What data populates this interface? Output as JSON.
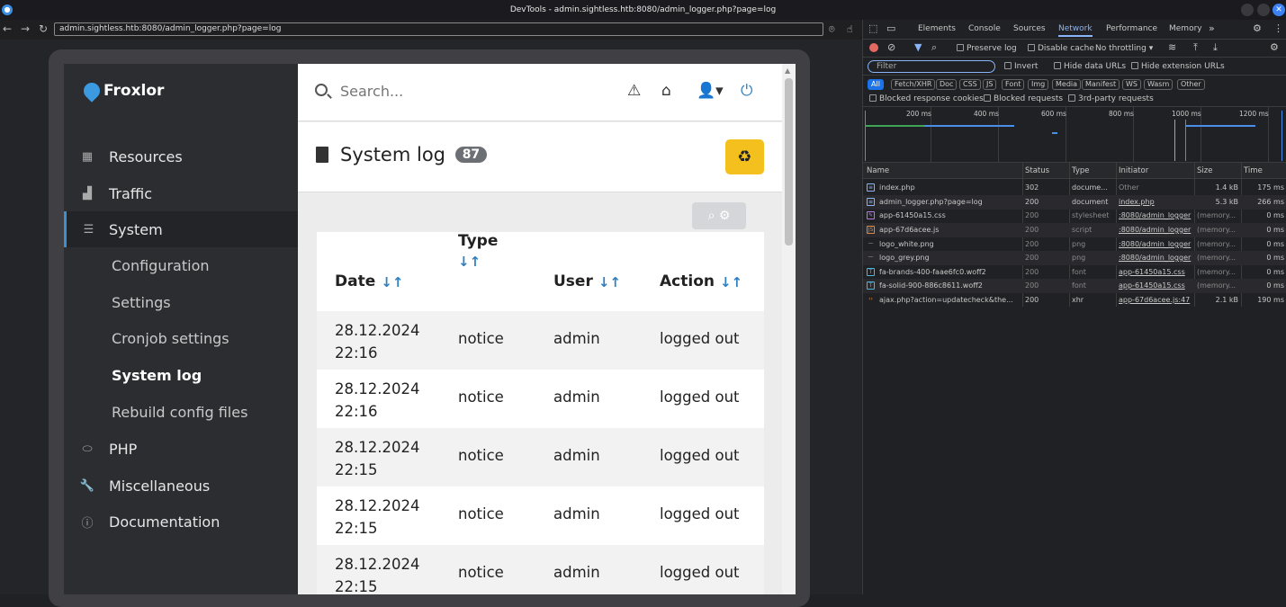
{
  "window": {
    "title": "DevTools - admin.sightless.htb:8080/admin_logger.php?page=log"
  },
  "browser": {
    "url": "admin.sightless.htb:8080/admin_logger.php?page=log"
  },
  "app": {
    "logo": "Froxlor",
    "search_placeholder": "Search...",
    "nav": [
      {
        "label": "Resources",
        "icon": "resources-icon"
      },
      {
        "label": "Traffic",
        "icon": "traffic-chart-icon"
      },
      {
        "label": "System",
        "icon": "server-icon"
      },
      {
        "label": "PHP",
        "icon": "php-icon"
      },
      {
        "label": "Miscellaneous",
        "icon": "wrench-icon"
      },
      {
        "label": "Documentation",
        "icon": "info-icon"
      }
    ],
    "system_sub": [
      "Configuration",
      "Settings",
      "Cronjob settings",
      "System log",
      "Rebuild config files"
    ],
    "page_title": "System log",
    "count": "87",
    "table": {
      "headers": [
        "Date",
        "Type",
        "User",
        "Action"
      ],
      "sort_glyph": "↓↑",
      "rows": [
        {
          "date1": "28.12.2024",
          "date2": "22:16",
          "type": "notice",
          "user": "admin",
          "action": "logged out"
        },
        {
          "date1": "28.12.2024",
          "date2": "22:16",
          "type": "notice",
          "user": "admin",
          "action": "logged out"
        },
        {
          "date1": "28.12.2024",
          "date2": "22:15",
          "type": "notice",
          "user": "admin",
          "action": "logged out"
        },
        {
          "date1": "28.12.2024",
          "date2": "22:15",
          "type": "notice",
          "user": "admin",
          "action": "logged out"
        },
        {
          "date1": "28.12.2024",
          "date2": "22:15",
          "type": "notice",
          "user": "admin",
          "action": "logged out"
        }
      ]
    }
  },
  "devtools": {
    "tabs": [
      "Elements",
      "Console",
      "Sources",
      "Network",
      "Performance",
      "Memory"
    ],
    "active_tab": "Network",
    "toolbar": {
      "preserve_log": "Preserve log",
      "disable_cache": "Disable cache",
      "throttling": "No throttling"
    },
    "filter_placeholder": "Filter",
    "filter_opts": [
      "Invert",
      "Hide data URLs",
      "Hide extension URLs"
    ],
    "types": [
      "All",
      "Fetch/XHR",
      "Doc",
      "CSS",
      "JS",
      "Font",
      "Img",
      "Media",
      "Manifest",
      "WS",
      "Wasm",
      "Other"
    ],
    "blocked_opts": [
      "Blocked response cookies",
      "Blocked requests",
      "3rd-party requests"
    ],
    "timeline_ticks": [
      "200 ms",
      "400 ms",
      "600 ms",
      "800 ms",
      "1000 ms",
      "1200 ms"
    ],
    "columns": [
      "Name",
      "Status",
      "Type",
      "Initiator",
      "Size",
      "Time"
    ],
    "requests": [
      {
        "name": "index.php",
        "status": "302",
        "type": "docume...",
        "initiator": "Other",
        "size": "1.4 kB",
        "time": "175 ms"
      },
      {
        "name": "admin_logger.php?page=log",
        "status": "200",
        "type": "document",
        "initiator": "index.php",
        "size": "5.3 kB",
        "time": "266 ms"
      },
      {
        "name": "app-61450a15.css",
        "status": "200",
        "type": "stylesheet",
        "initiator": ":8080/admin_logger",
        "size": "(memory...",
        "time": "0 ms"
      },
      {
        "name": "app-67d6acee.js",
        "status": "200",
        "type": "script",
        "initiator": ":8080/admin_logger",
        "size": "(memory...",
        "time": "0 ms"
      },
      {
        "name": "logo_white.png",
        "status": "200",
        "type": "png",
        "initiator": ":8080/admin_logger",
        "size": "(memory...",
        "time": "0 ms"
      },
      {
        "name": "logo_grey.png",
        "status": "200",
        "type": "png",
        "initiator": ":8080/admin_logger",
        "size": "(memory...",
        "time": "0 ms"
      },
      {
        "name": "fa-brands-400-faae6fc0.woff2",
        "status": "200",
        "type": "font",
        "initiator": "app-61450a15.css",
        "size": "(memory...",
        "time": "0 ms"
      },
      {
        "name": "fa-solid-900-886c8611.woff2",
        "status": "200",
        "type": "font",
        "initiator": "app-61450a15.css",
        "size": "(memory...",
        "time": "0 ms"
      },
      {
        "name": "ajax.php?action=updatecheck&the...",
        "status": "200",
        "type": "xhr",
        "initiator": "app-67d6acee.js:47",
        "size": "2.1 kB",
        "time": "190 ms"
      }
    ]
  }
}
